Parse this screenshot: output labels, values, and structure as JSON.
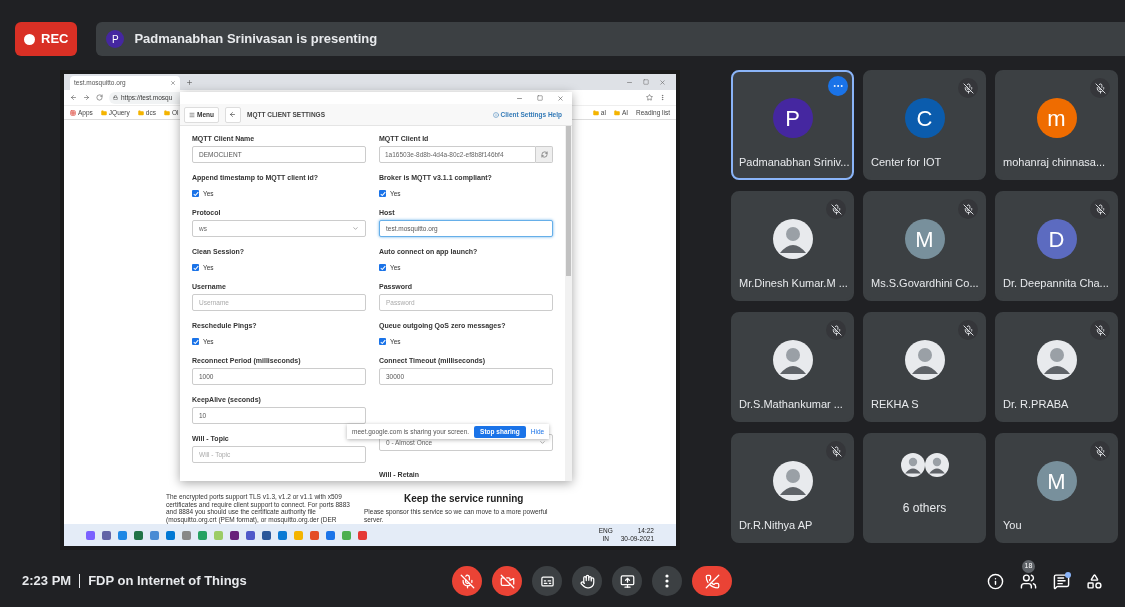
{
  "recording": {
    "label": "REC"
  },
  "presenting_banner": {
    "avatar_letter": "P",
    "text": "Padmanabhan Srinivasan is presenting"
  },
  "shared_screen": {
    "browser": {
      "tab_title": "test.mosquitto.org",
      "url": "https://test.mosqu",
      "bookmarks": [
        "Apps",
        "JQuery",
        "dcs",
        "Ol"
      ],
      "bookmarks_right": [
        "al",
        "AI"
      ],
      "reading_list": "Reading list"
    },
    "page": {
      "paragraph": "The encrypted ports support TLS v1.3, v1.2 or v1.1 with x509 certificates and require client support to connect. For ports 8883 and 8884 you should use the certificate authority file (mosquitto.org.crt (PEM format), or mosquitto.org.der (DER",
      "heading": "Keep the service running",
      "sponsor": "Please sponsor this service so we can move to a more powerful server."
    },
    "dialog": {
      "menu_button": "Menu",
      "title": "MQTT CLIENT SETTINGS",
      "help_link": "Client Settings Help",
      "rows": [
        [
          {
            "kind": "text",
            "label": "MQTT Client Name",
            "value": "DEMOCLIENT",
            "focused": false
          },
          {
            "kind": "id",
            "label": "MQTT Client Id",
            "value": "1a16503e-8d8b-4d4a-80c2-ef8b8f146bf4"
          }
        ],
        [
          {
            "kind": "checkbox",
            "label": "Append timestamp to MQTT client id?",
            "option": "Yes",
            "checked": true
          },
          {
            "kind": "checkbox",
            "label": "Broker is MQTT v3.1.1 compliant?",
            "option": "Yes",
            "checked": true
          }
        ],
        [
          {
            "kind": "select",
            "label": "Protocol",
            "value": "ws"
          },
          {
            "kind": "text",
            "label": "Host",
            "value": "test.mosquitto.org",
            "focused": true
          }
        ],
        [
          {
            "kind": "checkbox",
            "label": "Clean Session?",
            "option": "Yes",
            "checked": true
          },
          {
            "kind": "checkbox",
            "label": "Auto connect on app launch?",
            "option": "Yes",
            "checked": true
          }
        ],
        [
          {
            "kind": "text",
            "label": "Username",
            "placeholder": "Username",
            "focused": false
          },
          {
            "kind": "text",
            "label": "Password",
            "placeholder": "Password",
            "focused": false
          }
        ],
        [
          {
            "kind": "checkbox",
            "label": "Reschedule Pings?",
            "option": "Yes",
            "checked": true
          },
          {
            "kind": "checkbox",
            "label": "Queue outgoing QoS zero messages?",
            "option": "Yes",
            "checked": true
          }
        ],
        [
          {
            "kind": "text",
            "label": "Reconnect Period (milliseconds)",
            "value": "1000",
            "focused": false
          },
          {
            "kind": "text",
            "label": "Connect Timeout (milliseconds)",
            "value": "30000",
            "focused": false
          }
        ],
        [
          {
            "kind": "text",
            "label": "KeepAlive (seconds)",
            "value": "10",
            "focused": false
          }
        ],
        [
          {
            "kind": "text",
            "label": "Will - Topic",
            "placeholder": "Will - Topic",
            "focused": false
          },
          {
            "kind": "select",
            "value": "0 - Almost Once"
          }
        ]
      ],
      "trailing_label": "Will - Retain"
    },
    "share_notice": {
      "text": "meet.google.com is sharing your screen.",
      "stop_button": "Stop sharing",
      "hide_link": "Hide"
    },
    "taskbar": {
      "language": "ENG",
      "region": "IN",
      "time": "14:22",
      "date": "30-09-2021"
    }
  },
  "participants": [
    {
      "name": "Padmanabhan Sriniv...",
      "kind": "letter",
      "letter": "P",
      "color": "#4527a0",
      "selected": true,
      "muted": false
    },
    {
      "name": "Center for IOT",
      "kind": "letter",
      "letter": "C",
      "color": "#0b5cad",
      "selected": false,
      "muted": true
    },
    {
      "name": "mohanraj chinnasa...",
      "kind": "letter",
      "letter": "m",
      "color": "#ef6c00",
      "selected": false,
      "muted": true
    },
    {
      "name": "Mr.Dinesh Kumar.M ...",
      "kind": "photo",
      "selected": false,
      "muted": true
    },
    {
      "name": "Ms.S.Govardhini Co...",
      "kind": "letter",
      "letter": "M",
      "color": "#78909c",
      "selected": false,
      "muted": true
    },
    {
      "name": "Dr. Deepannita Cha...",
      "kind": "letter",
      "letter": "D",
      "color": "#5c6bc0",
      "selected": false,
      "muted": true
    },
    {
      "name": "Dr.S.Mathankumar ...",
      "kind": "photo",
      "selected": false,
      "muted": true
    },
    {
      "name": "REKHA S",
      "kind": "photo",
      "selected": false,
      "muted": true
    },
    {
      "name": "Dr. R.PRABA",
      "kind": "photo",
      "selected": false,
      "muted": true
    },
    {
      "name": "Dr.R.Nithya AP",
      "kind": "photo",
      "selected": false,
      "muted": true
    },
    {
      "name": "6 others",
      "kind": "group",
      "selected": false,
      "muted": false
    },
    {
      "name": "You",
      "kind": "letter",
      "letter": "M",
      "color": "#78909c",
      "selected": false,
      "muted": true
    }
  ],
  "bottom_bar": {
    "time": "2:23 PM",
    "meeting_title": "FDP on Internet of Things",
    "controls": [
      {
        "kind": "mic",
        "on": false
      },
      {
        "kind": "camera",
        "on": false
      },
      {
        "kind": "captions",
        "on": false
      },
      {
        "kind": "hand",
        "on": false
      },
      {
        "kind": "present",
        "on": false
      },
      {
        "kind": "more",
        "on": false
      },
      {
        "kind": "end",
        "on": false
      }
    ],
    "people_count": "18",
    "chat_unread": true
  }
}
